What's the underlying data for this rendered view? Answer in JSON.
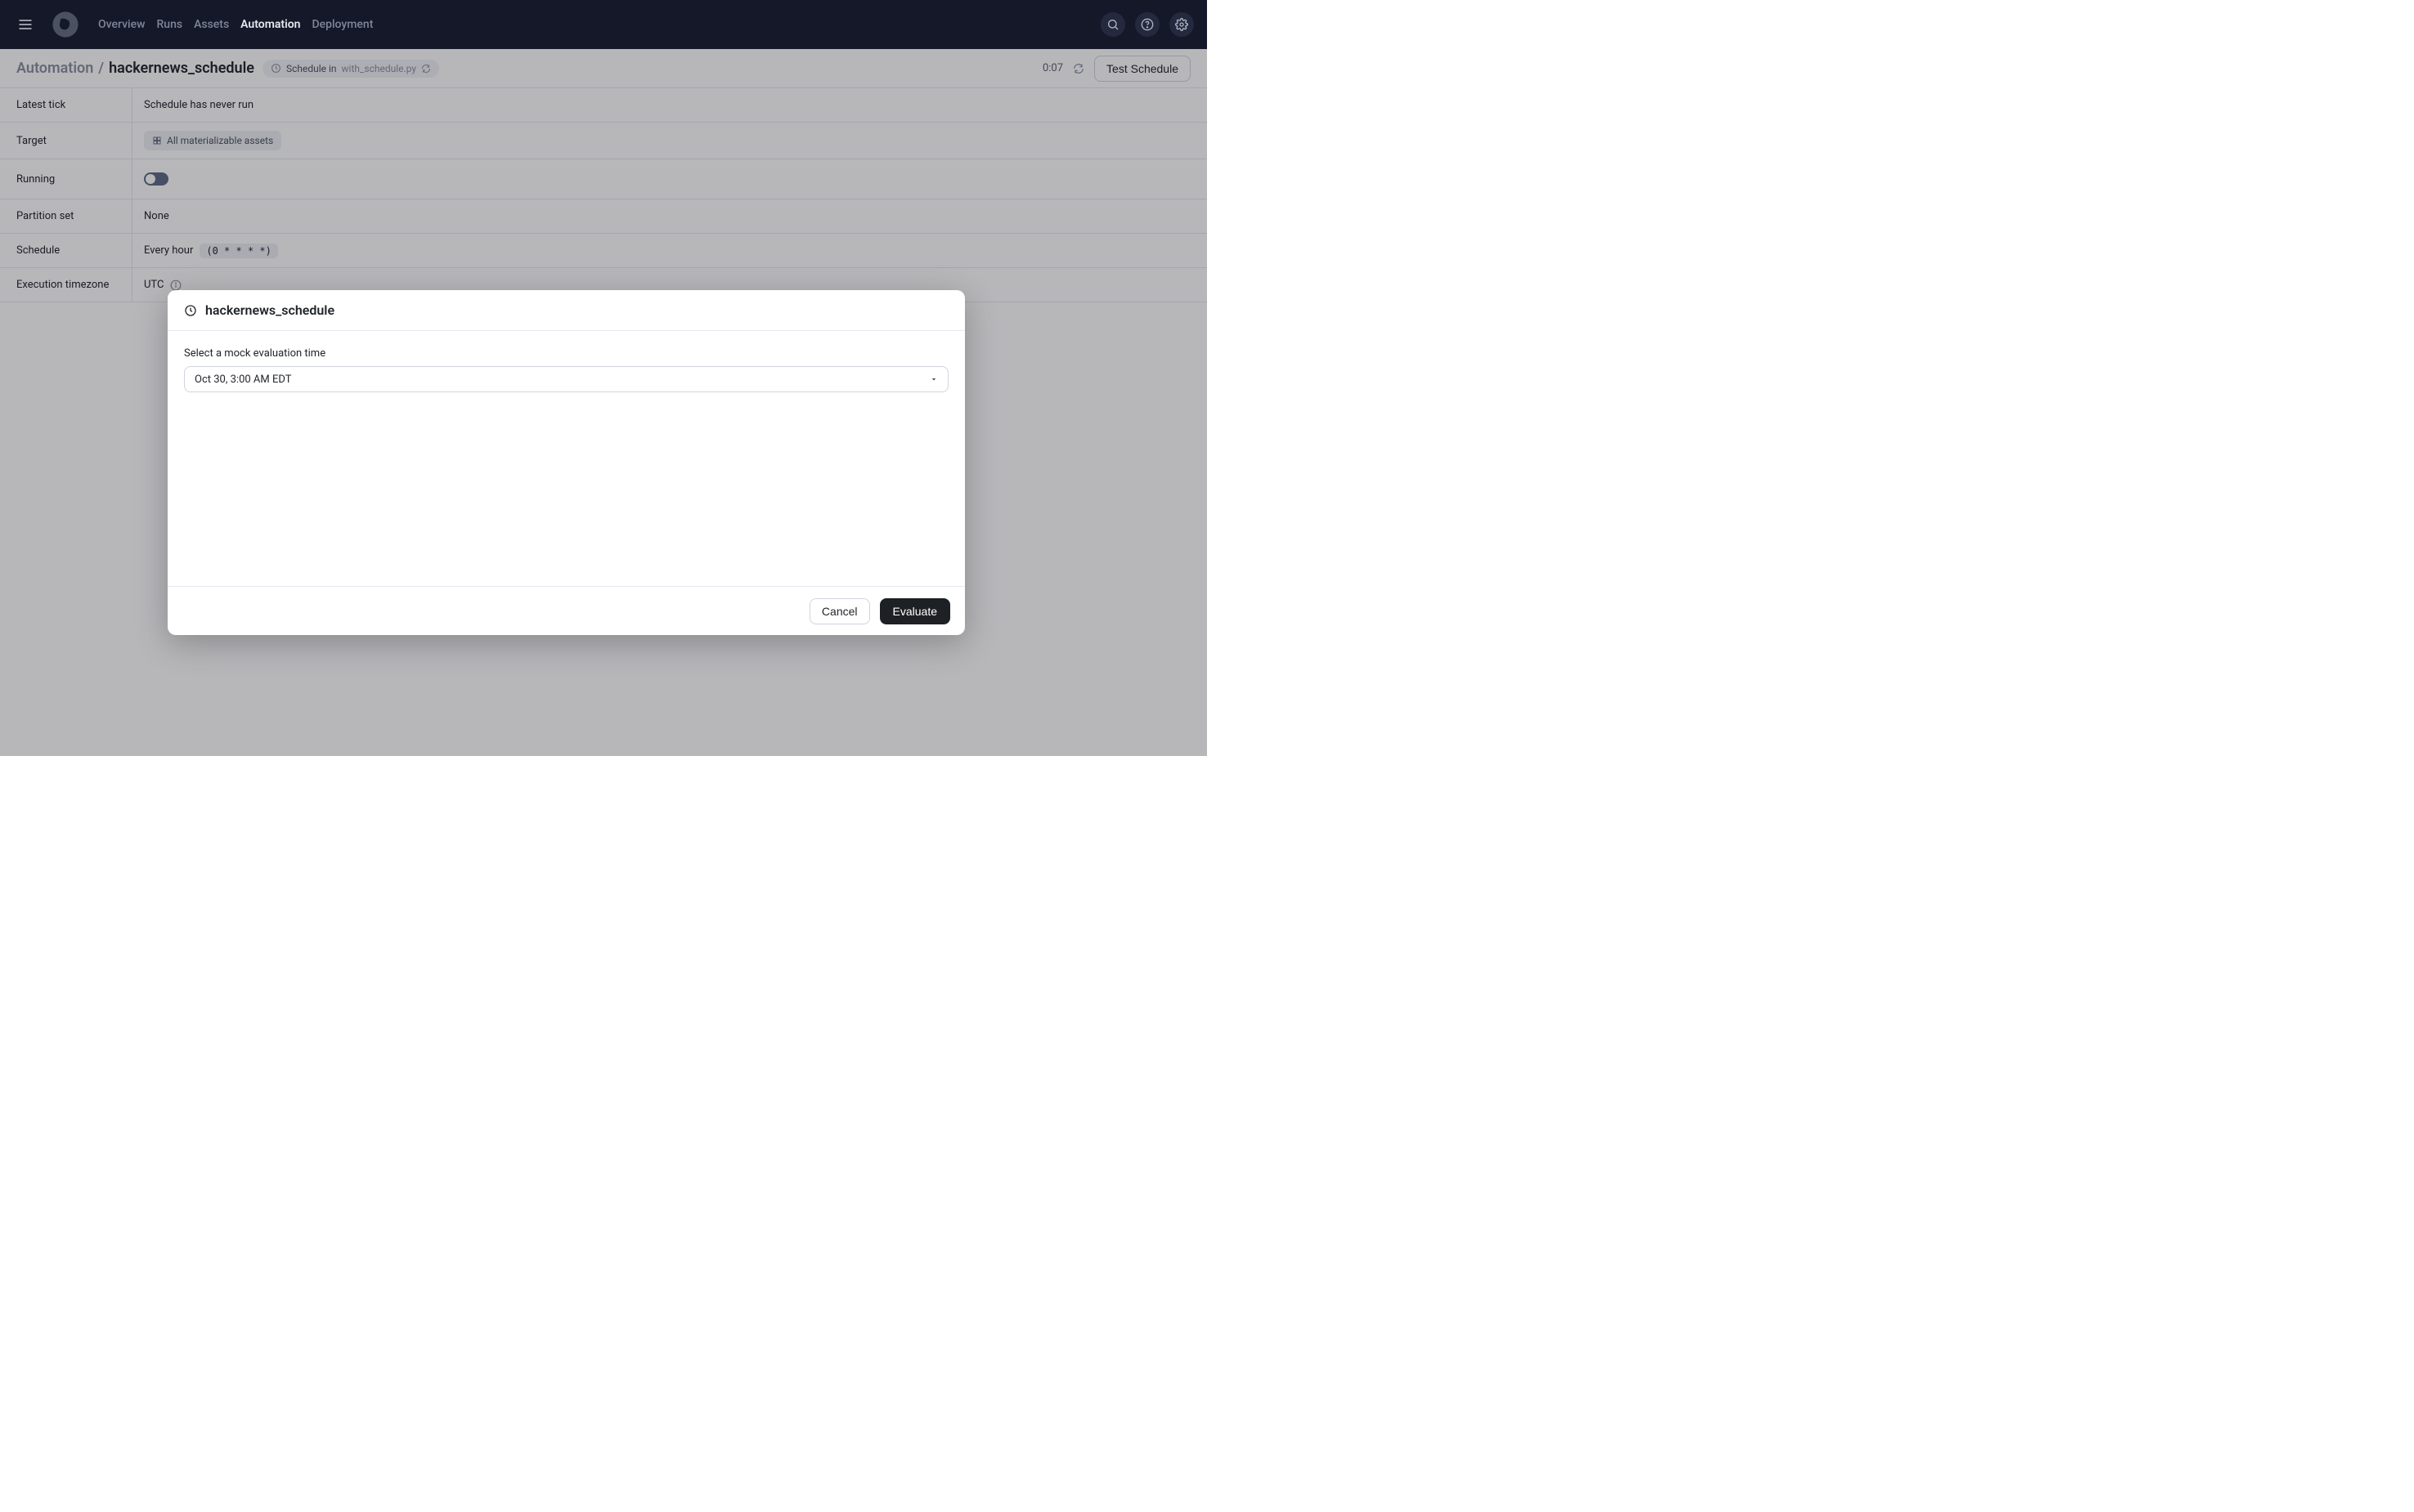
{
  "nav": {
    "items": [
      "Overview",
      "Runs",
      "Assets",
      "Automation",
      "Deployment"
    ],
    "activeIndex": 3
  },
  "breadcrumb": {
    "root": "Automation",
    "sep": "/",
    "name": "hackernews_schedule"
  },
  "pill": {
    "prefix": "Schedule in",
    "file": "with_schedule.py"
  },
  "topRight": {
    "time": "0:07",
    "testBtn": "Test Schedule"
  },
  "rows": {
    "latestTick": {
      "label": "Latest tick",
      "value": "Schedule has never run"
    },
    "target": {
      "label": "Target",
      "chip": "All materializable assets"
    },
    "running": {
      "label": "Running"
    },
    "partition": {
      "label": "Partition set",
      "value": "None"
    },
    "schedule": {
      "label": "Schedule",
      "text": "Every hour",
      "cron": "(0 * * * *)"
    },
    "tz": {
      "label": "Execution timezone",
      "value": "UTC"
    }
  },
  "modal": {
    "title": "hackernews_schedule",
    "fieldLabel": "Select a mock evaluation time",
    "value": "Oct 30, 3:00 AM EDT",
    "cancel": "Cancel",
    "evaluate": "Evaluate"
  }
}
